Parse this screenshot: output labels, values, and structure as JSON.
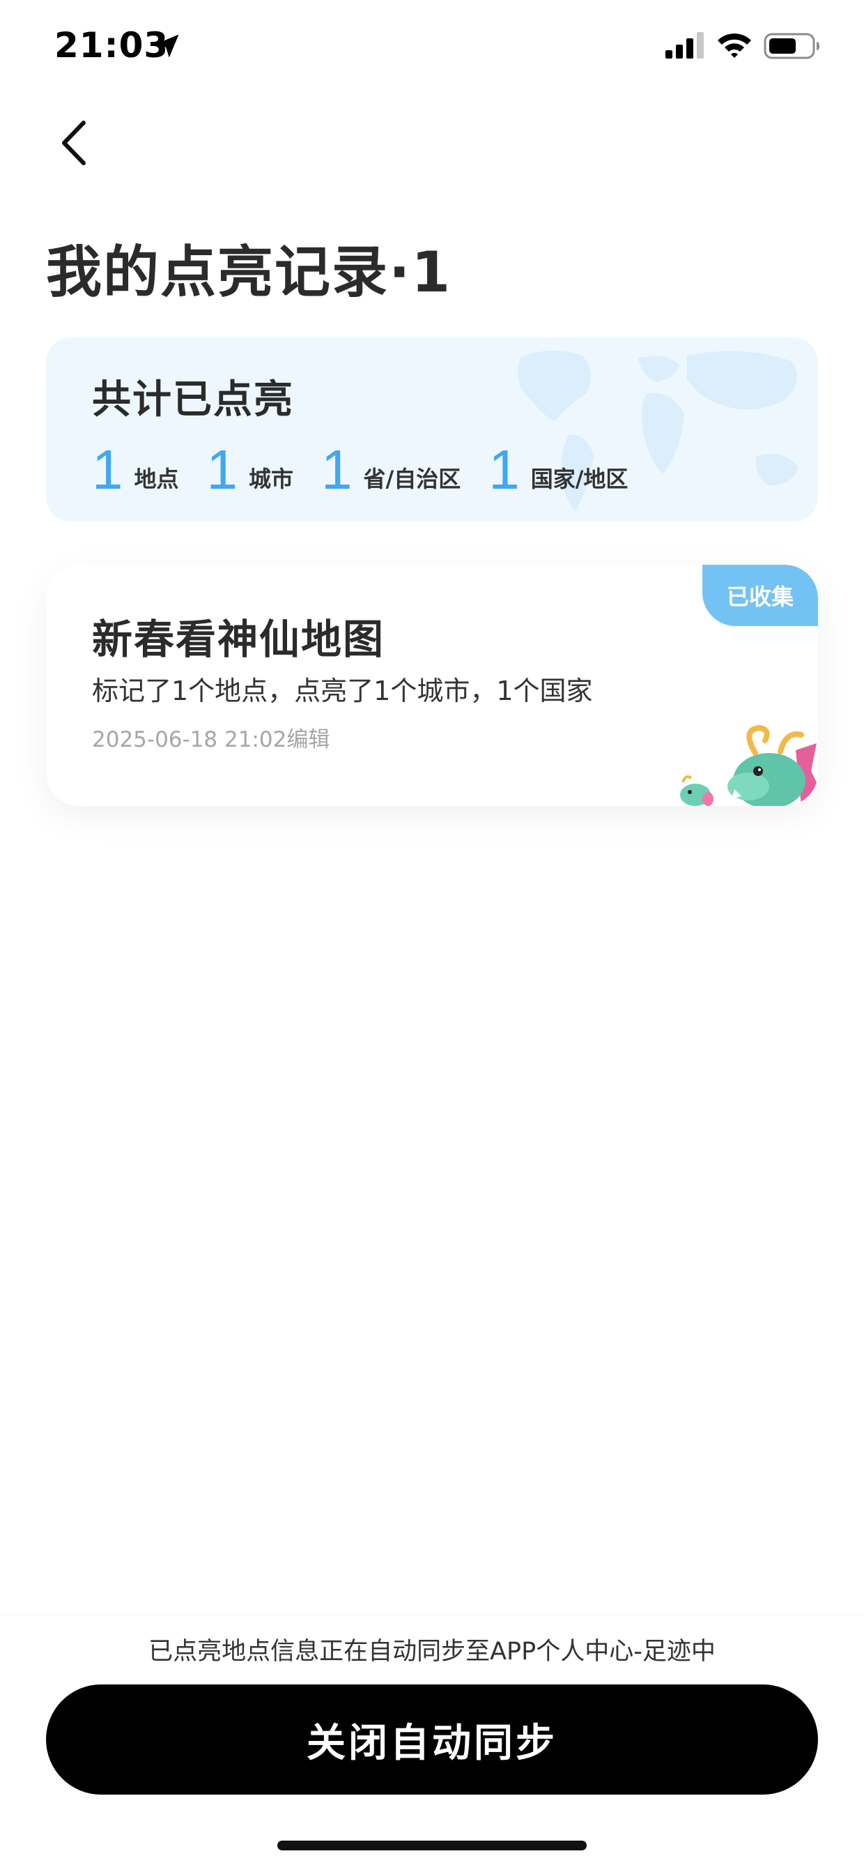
{
  "status_bar": {
    "time": "21:03",
    "icons": [
      "location-arrow-icon",
      "cellular-signal-icon",
      "wifi-icon",
      "battery-icon"
    ]
  },
  "nav": {
    "back_icon": "chevron-left-icon"
  },
  "page": {
    "title": "我的点亮记录·1"
  },
  "summary": {
    "title": "共计已点亮",
    "stats": [
      {
        "value": "1",
        "label": "地点"
      },
      {
        "value": "1",
        "label": "城市"
      },
      {
        "value": "1",
        "label": "省/自治区"
      },
      {
        "value": "1",
        "label": "国家/地区"
      }
    ],
    "background_icon": "world-map-icon"
  },
  "record": {
    "badge": "已收集",
    "title": "新春看神仙地图",
    "description": "标记了1个地点，点亮了1个城市，1个国家",
    "time": "2025-06-18 21:02编辑",
    "decoration_icon": "dragon-mascot-icon"
  },
  "footer": {
    "sync_note": "已点亮地点信息正在自动同步至APP个人中心-足迹中",
    "button_label": "关闭自动同步"
  },
  "colors": {
    "accent": "#42a7ee",
    "badge": "#72c3f3",
    "summary_bg": "#eef7fe",
    "button_bg": "#000000"
  }
}
